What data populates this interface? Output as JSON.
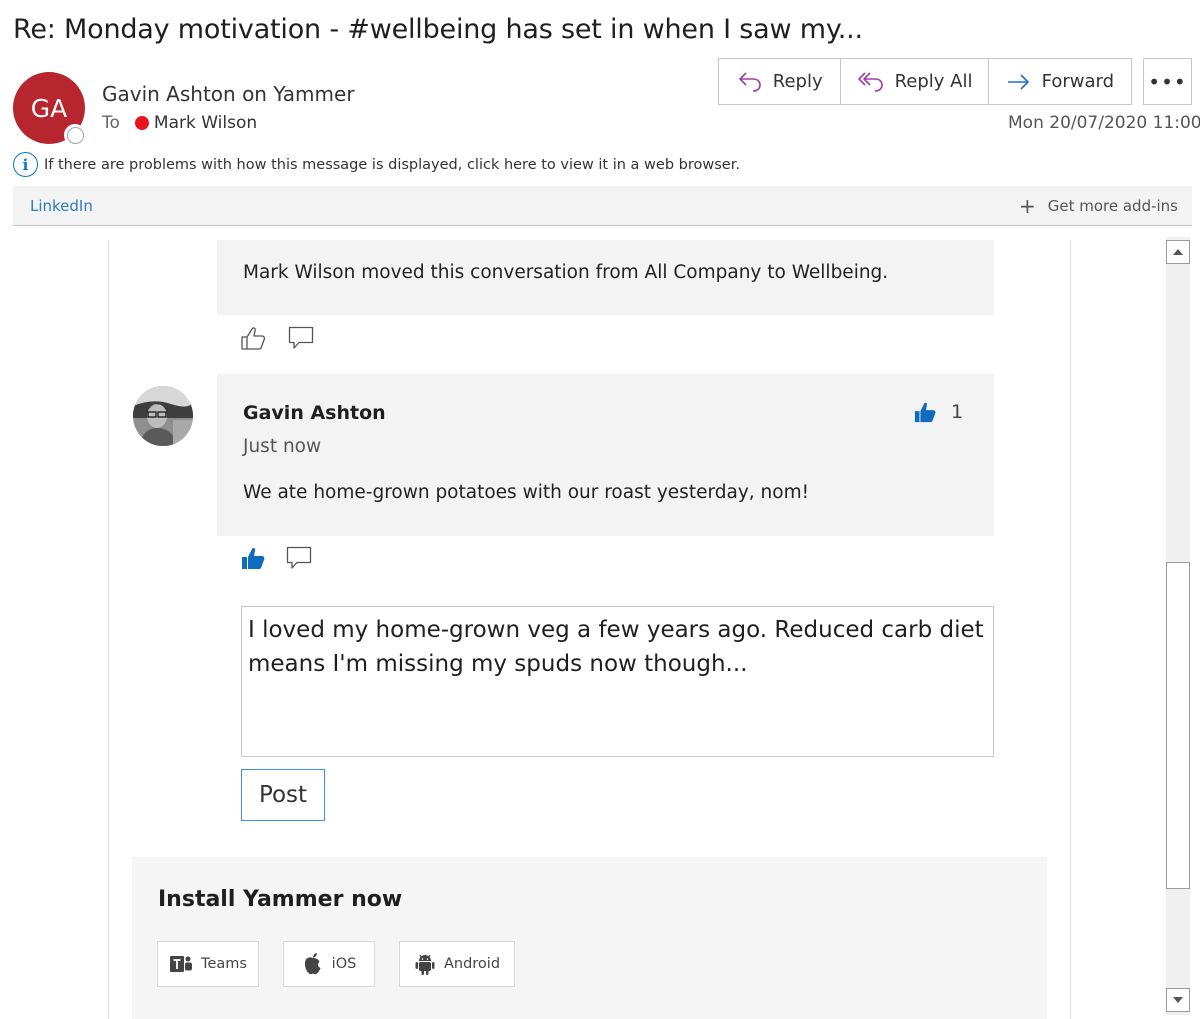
{
  "email": {
    "subject": "Re: Monday motivation - #wellbeing has set in when I saw my...",
    "avatar_initials": "GA",
    "sender": "Gavin Ashton on Yammer",
    "to_label": "To",
    "recipient": "Mark Wilson",
    "date": "Mon 20/07/2020 11:00",
    "info_text": "If there are problems with how this message is displayed, click here to view it in a web browser.",
    "colors": {
      "avatar_bg": "#b7252f",
      "presence_busy": "#e8141f",
      "link_blue": "#0078d4",
      "like_blue": "#0f6cbd"
    }
  },
  "actions": {
    "reply": "Reply",
    "reply_all": "Reply All",
    "forward": "Forward",
    "more": "•••"
  },
  "addins": {
    "linkedin": "LinkedIn",
    "get_more": "Get more add-ins"
  },
  "yammer": {
    "system_message": "Mark Wilson moved this conversation from All Company to Wellbeing.",
    "post": {
      "author": "Gavin Ashton",
      "time": "Just now",
      "body": "We ate home-grown potatoes with our roast yesterday, nom!",
      "like_count": "1"
    },
    "reply_text": "I loved my home-grown veg a few years ago. Reduced carb diet means I'm missing my spuds now though...",
    "post_button": "Post",
    "install": {
      "title": "Install Yammer now",
      "apps": [
        "Teams",
        "iOS",
        "Android"
      ]
    }
  }
}
